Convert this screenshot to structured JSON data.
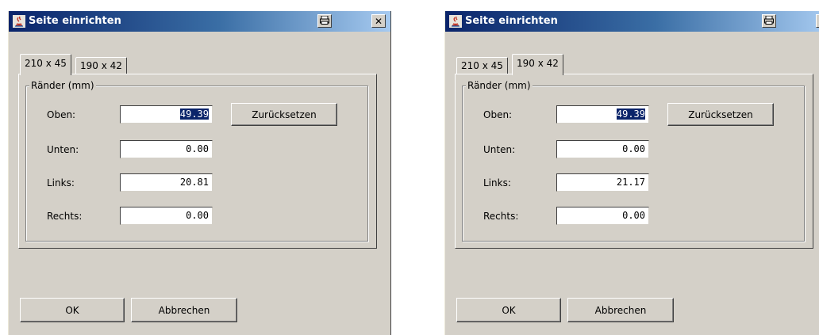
{
  "dialogs": [
    {
      "title": "Seite einrichten",
      "tabs": [
        "210 x 45",
        "190 x 42"
      ],
      "active_tab": 0,
      "group_label": "Ränder (mm)",
      "fields": [
        {
          "label": "Oben:",
          "value": "49.39",
          "selected": true
        },
        {
          "label": "Unten:",
          "value": "0.00",
          "selected": false
        },
        {
          "label": "Links:",
          "value": "20.81",
          "selected": false
        },
        {
          "label": "Rechts:",
          "value": "0.00",
          "selected": false
        }
      ],
      "reset_label": "Zurücksetzen",
      "ok_label": "OK",
      "cancel_label": "Abbrechen",
      "close_glyph": "✕",
      "icons": {
        "app": "java-icon",
        "print": "printer-icon",
        "close": "close-icon"
      }
    },
    {
      "title": "Seite einrichten",
      "tabs": [
        "210 x 45",
        "190 x 42"
      ],
      "active_tab": 1,
      "group_label": "Ränder (mm)",
      "fields": [
        {
          "label": "Oben:",
          "value": "49.39",
          "selected": true
        },
        {
          "label": "Unten:",
          "value": "0.00",
          "selected": false
        },
        {
          "label": "Links:",
          "value": "21.17",
          "selected": false
        },
        {
          "label": "Rechts:",
          "value": "0.00",
          "selected": false
        }
      ],
      "reset_label": "Zurücksetzen",
      "ok_label": "OK",
      "cancel_label": "Abbrechen",
      "close_glyph": "✕",
      "icons": {
        "app": "java-icon",
        "print": "printer-icon",
        "close": "close-icon"
      }
    }
  ],
  "colors": {
    "titlebar_start": "#0a246a",
    "titlebar_end": "#a6caf0",
    "face": "#d4d0c8",
    "selection": "#0a246a"
  }
}
